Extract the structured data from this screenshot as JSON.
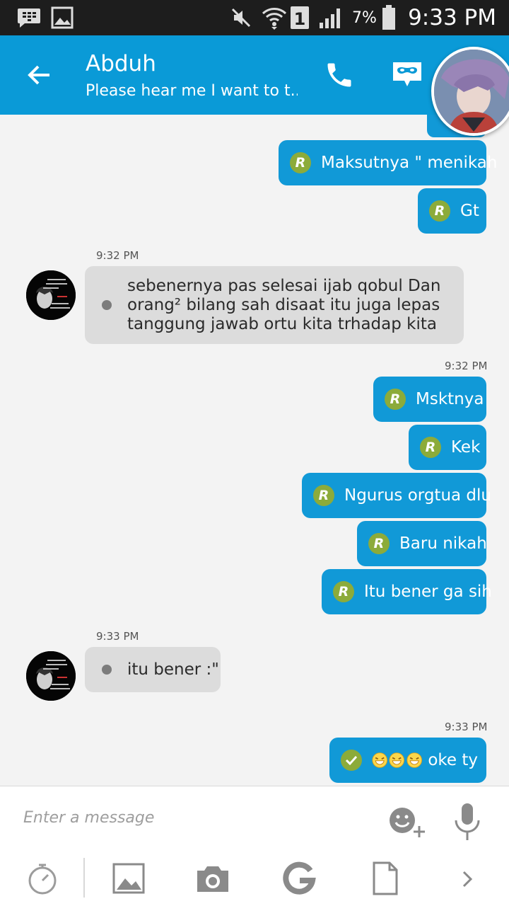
{
  "status_bar": {
    "battery_percent": "7%",
    "time": "9:33 PM",
    "icons": [
      "bbm-notification-icon",
      "image-notification-icon",
      "mute-icon",
      "wifi-icon",
      "sim-1-icon",
      "signal-icon",
      "battery-icon"
    ]
  },
  "header": {
    "contact_name": "Abduh",
    "status_message": "Please hear me I want to t...",
    "icons": [
      "back-arrow-icon",
      "phone-icon",
      "mask-icon",
      "contact-avatar"
    ]
  },
  "messages": [
    {
      "direction": "out",
      "badge": "R",
      "text": "Maksutnya \" menikah"
    },
    {
      "direction": "out",
      "badge": "R",
      "text": "Gt"
    },
    {
      "direction": "in",
      "time": "9:32 PM",
      "text": "sebenernya pas selesai ijab qobul Dan orang² bilang sah disaat itu juga lepas tanggung jawab ortu kita trhadap kita"
    },
    {
      "direction": "out",
      "time": "9:32 PM",
      "badge": "R",
      "text": "Msktnya"
    },
    {
      "direction": "out",
      "badge": "R",
      "text": "Kek"
    },
    {
      "direction": "out",
      "badge": "R",
      "text": "Ngurus orgtua dlu"
    },
    {
      "direction": "out",
      "badge": "R",
      "text": "Baru nikah"
    },
    {
      "direction": "out",
      "badge": "R",
      "text": "Itu bener ga sih"
    },
    {
      "direction": "in",
      "time": "9:33 PM",
      "text": "itu bener :\""
    },
    {
      "direction": "out",
      "time": "9:33 PM",
      "badge": "delivered",
      "emoji_count": 3,
      "text": "oke ty"
    }
  ],
  "composer": {
    "placeholder": "Enter a message",
    "icons": [
      "emoji-add-icon",
      "microphone-icon"
    ]
  },
  "toolbar": {
    "icons": [
      "timer-icon",
      "image-icon",
      "camera-icon",
      "google-icon",
      "file-icon",
      "chevron-right-icon"
    ]
  },
  "colors": {
    "header": "#0a9ad7",
    "outgoing_bubble": "#1199d7",
    "incoming_bubble": "#dcdcdc",
    "read_badge": "#8cab3a",
    "status_bar": "#1d1d1d"
  }
}
